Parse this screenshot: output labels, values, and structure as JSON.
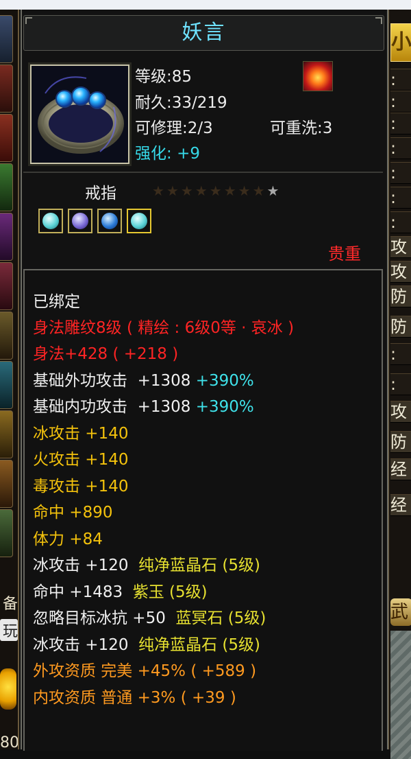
{
  "item": {
    "name": "妖言",
    "level": "等级:85",
    "durability": "耐久:33/219",
    "repairable": "可修理:2/3",
    "rewashable": "可重洗:3",
    "enhance_label": "强化:",
    "enhance_value": "+9",
    "type": "戒指",
    "rarity": "贵重",
    "stars_filled": 1,
    "stars_total": 9,
    "gems": [
      "ice-gem-icon",
      "purple-gem-icon",
      "blue-gem-icon",
      "ice-gem-icon"
    ]
  },
  "attributes": {
    "bound": "已绑定",
    "engraving": "身法雕纹8级 ( 精绘 : 6级0等 · 哀冰 )",
    "agility": "身法+428 ( +218 )",
    "outer_attack": {
      "label": "基础外功攻击",
      "value": "+1308",
      "pct": "+390%"
    },
    "inner_attack": {
      "label": "基础内功攻击",
      "value": "+1308",
      "pct": "+390%"
    },
    "ice_attack": "冰攻击  +140",
    "fire_attack": "火攻击  +140",
    "poison_attack": "毒攻击  +140",
    "hit": "命中  +890",
    "stamina": "体力  +84",
    "gem1": {
      "text": "冰攻击  +120",
      "gem": "纯净蓝晶石 (5级)"
    },
    "gem2": {
      "text": "命中  +1483",
      "gem": "紫玉 (5级)"
    },
    "gem3": {
      "text": "忽略目标冰抗  +50",
      "gem": "蓝冥石 (5级)"
    },
    "gem4": {
      "text": "冰攻击  +120",
      "gem": "纯净蓝晶石 (5级)"
    },
    "outer_quality": "外攻资质    完美  +45% ( +589 )",
    "inner_quality": "内攻资质    普通  +3% ( +39 )"
  },
  "right_panel": {
    "top_button": "小",
    "labels": [
      ":",
      ":",
      ":",
      ":",
      ":",
      ":",
      ":",
      "攻",
      "攻",
      "防",
      "防",
      ":",
      ":",
      "攻",
      "防",
      "经",
      "经"
    ],
    "bottom_button": "武"
  },
  "left_panel": {
    "label_a": "备",
    "label_b": "玩",
    "number": "80"
  },
  "colors": {
    "title": "#6fe3ff",
    "rarity": "#ff2a2a",
    "enhance": "#36d9e8",
    "attr_yellow": "#f4c20c",
    "attr_orange": "#ff9a20",
    "attr_red": "#ff2424"
  }
}
